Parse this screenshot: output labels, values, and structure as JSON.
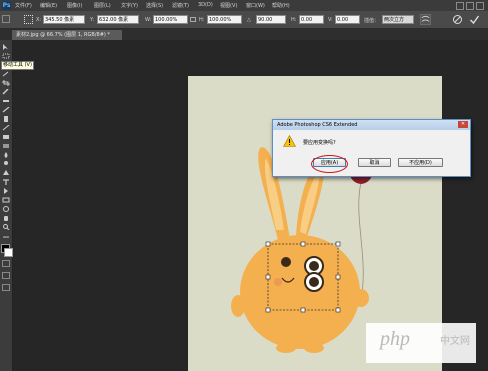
{
  "app": {
    "logo": "Ps"
  },
  "menu": [
    "文件(F)",
    "编辑(E)",
    "图像(I)",
    "图层(L)",
    "文字(Y)",
    "选择(S)",
    "滤镜(T)",
    "3D(D)",
    "视图(V)",
    "窗口(W)",
    "帮助(H)"
  ],
  "options": {
    "x_label": "X:",
    "x_value": "345.50 像素",
    "y_label": "Y:",
    "y_value": "632.00 像素",
    "w_label": "W:",
    "w_value": "100.00%",
    "h_label": "H:",
    "h_value": "100.00%",
    "angle_label": "△",
    "angle_value": "90.00",
    "hskew_label": "H:",
    "hskew_value": "0.00",
    "vskew_label": "V:",
    "vskew_value": "0.00",
    "interp_label": "插值：",
    "interp_value": "两次立方"
  },
  "document": {
    "tab_title": "素材2.jpg @ 66.7% (图层 1, RGB/8#) *"
  },
  "tooltip": "移动工具 (V)",
  "dialog": {
    "title": "Adobe Photoshop CS6 Extended",
    "message": "要应用变换吗?",
    "apply_label": "应用(A)",
    "cancel_label": "取消",
    "dont_apply_label": "不应用(D)"
  },
  "watermark": {
    "text": "php",
    "cn": "中文网"
  },
  "colors": {
    "ui_dark": "#3c3c3c",
    "canvas_bg": "#dbdcc8",
    "rabbit_body": "#f4b04f",
    "balloon": "#8f1f2b",
    "dialog_border": "#5d8fc7",
    "highlight": "#d01818"
  }
}
